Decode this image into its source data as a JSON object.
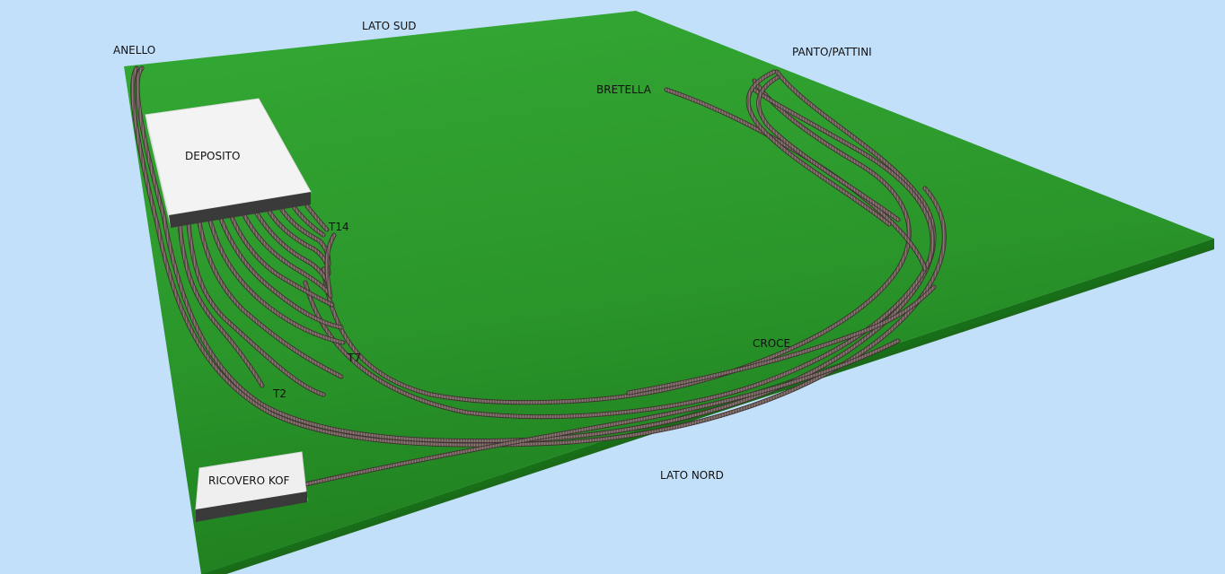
{
  "scene": {
    "background_color": "#c3e0fb",
    "baseboard_color": "#2a9a2a",
    "baseboard_edge_color": "#1a6a1a",
    "track_color": "#5a4a48",
    "building_color": "#f2f2f2",
    "building_base_color": "#3a3a3a"
  },
  "labels": {
    "lato_sud": "LATO SUD",
    "lato_nord": "LATO NORD",
    "anello": "ANELLO",
    "panto_pattini": "PANTO/PATTINI",
    "bretella": "BRETELLA",
    "deposito": "DEPOSITO",
    "t14": "T14",
    "t7": "T7",
    "t2": "T2",
    "croce": "CROCE",
    "ricovero_kof": "RICOVERO KOF"
  }
}
